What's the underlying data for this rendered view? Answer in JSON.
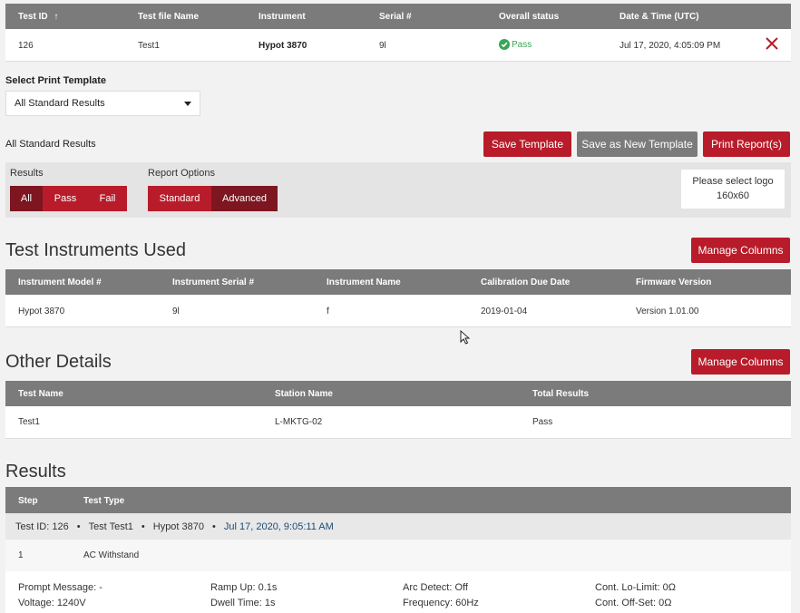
{
  "test_table": {
    "headers": [
      "Test ID",
      "Test file Name",
      "Instrument",
      "Serial #",
      "Overall status",
      "Date & Time (UTC)"
    ],
    "sort_arrow": "↑",
    "row": {
      "test_id": "126",
      "file_name": "Test1",
      "instrument": "Hypot 3870",
      "serial": "9l",
      "status": "Pass",
      "datetime": "Jul 17, 2020, 4:05:09 PM"
    }
  },
  "print_template": {
    "label": "Select Print Template",
    "selected": "All Standard Results",
    "current_name": "All Standard Results"
  },
  "toolbar": {
    "save_template": "Save Template",
    "save_as_new": "Save as New Template",
    "print_reports": "Print Report(s)"
  },
  "filters": {
    "results_label": "Results",
    "results_options": [
      "All",
      "Pass",
      "Fail"
    ],
    "report_options_label": "Report Options",
    "report_options": [
      "Standard",
      "Advanced"
    ],
    "logo_line1": "Please select logo",
    "logo_line2": "160x60"
  },
  "instruments": {
    "title": "Test Instruments Used",
    "manage_columns": "Manage Columns",
    "headers": [
      "Instrument Model #",
      "Instrument Serial #",
      "Instrument Name",
      "Calibration Due Date",
      "Firmware Version"
    ],
    "row": [
      "Hypot 3870",
      "9l",
      "f",
      "2019-01-04",
      "Version 1.01.00"
    ]
  },
  "other_details": {
    "title": "Other Details",
    "manage_columns": "Manage Columns",
    "headers": [
      "Test Name",
      "Station Name",
      "Total Results"
    ],
    "row": [
      "Test1",
      "L-MKTG-02",
      "Pass"
    ]
  },
  "results": {
    "title": "Results",
    "headers": [
      "Step",
      "Test Type"
    ],
    "group": {
      "test_id": "Test ID: 126",
      "test_name": "Test Test1",
      "instrument": "Hypot 3870",
      "date": "Jul 17, 2020, 9:05:11 AM",
      "separator": "•"
    },
    "step_row": {
      "step": "1",
      "type": "AC Withstand"
    },
    "params": [
      [
        "Prompt Message: -",
        "Ramp Up: 0.1s",
        "Arc Detect: Off",
        "Cont. Lo-Limit: 0Ω"
      ],
      [
        "Voltage: 1240V",
        "Dwell Time: 1s",
        "Frequency: 60Hz",
        "Cont. Off-Set: 0Ω"
      ]
    ]
  },
  "colors": {
    "header_gray": "#7b7b7b",
    "brand_red": "#b81c2a",
    "dark_red": "#7d1620",
    "pass_green": "#3aa655"
  }
}
